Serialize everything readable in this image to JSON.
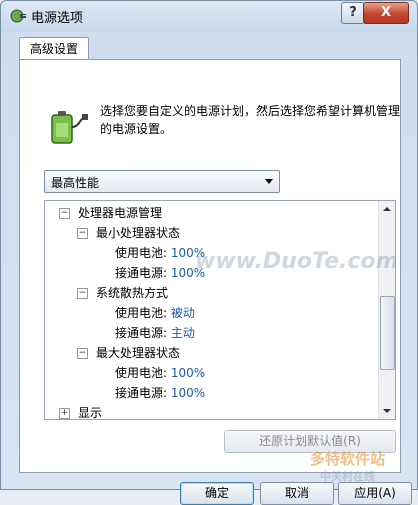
{
  "window": {
    "title": "电源选项",
    "help_label": "?",
    "close_label": "X"
  },
  "tab": {
    "label": "高级设置"
  },
  "description": "选择您要自定义的电源计划，然后选择您希望计算机管理的电源设置。",
  "plan_select": {
    "value": "最高性能"
  },
  "tree": [
    {
      "sign": "−",
      "label": "处理器电源管理",
      "value": ""
    },
    {
      "sign": "−",
      "label": "最小处理器状态",
      "value": ""
    },
    {
      "sign": "",
      "label": "使用电池:",
      "value": "100%"
    },
    {
      "sign": "",
      "label": "接通电源:",
      "value": "100%"
    },
    {
      "sign": "−",
      "label": "系统散热方式",
      "value": ""
    },
    {
      "sign": "",
      "label": "使用电池:",
      "value": "被动"
    },
    {
      "sign": "",
      "label": "接通电源:",
      "value": "主动"
    },
    {
      "sign": "−",
      "label": "最大处理器状态",
      "value": ""
    },
    {
      "sign": "",
      "label": "使用电池:",
      "value": "100%"
    },
    {
      "sign": "",
      "label": "接通电源:",
      "value": "100%"
    },
    {
      "sign": "+",
      "label": "显示",
      "value": ""
    }
  ],
  "buttons": {
    "restore": "还原计划默认值(R)",
    "ok": "确定",
    "cancel": "取消",
    "apply": "应用(A)"
  },
  "watermarks": {
    "main": "www.DuoTe.com",
    "corner": "多特软件站",
    "corner2": "中关村在线"
  }
}
